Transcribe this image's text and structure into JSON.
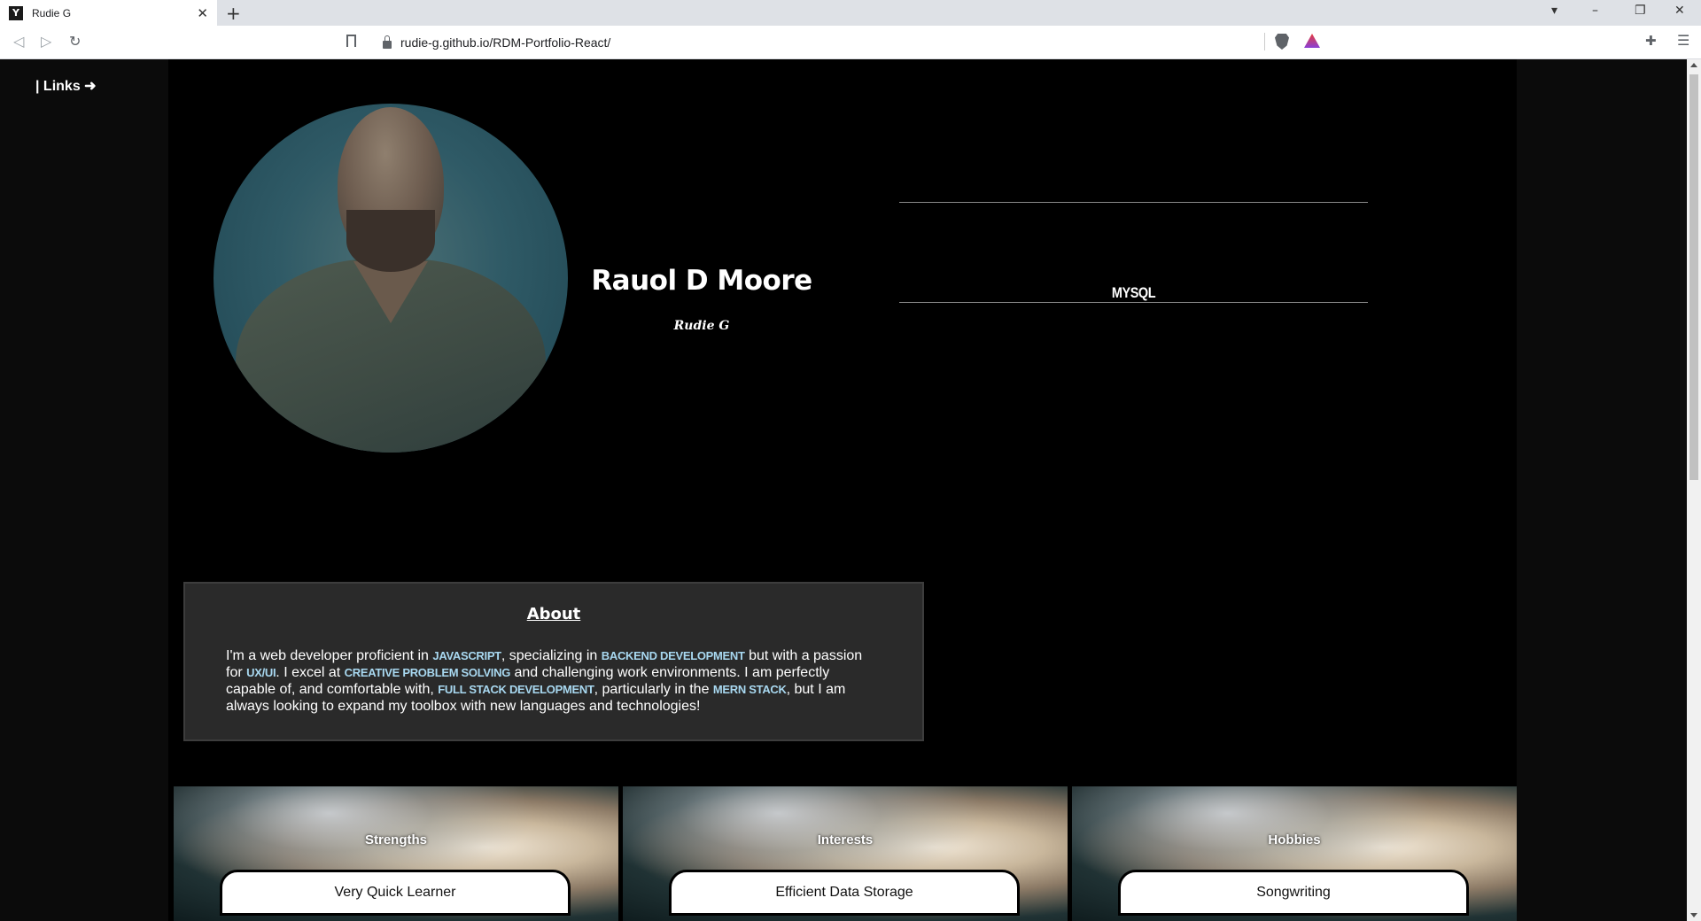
{
  "browser": {
    "tab_title": "Rudie G",
    "url": "rudie-g.github.io/RDM-Portfolio-React/"
  },
  "sidebar": {
    "links_label": "| Links ➜"
  },
  "profile": {
    "name": "Rauol D Moore",
    "nickname": "Rudie G",
    "current_skill": "MYSQL"
  },
  "about": {
    "title": "About",
    "p1": "I'm a web developer proficient in ",
    "h1": "JAVASCRIPT",
    "p2": ", specializing in ",
    "h2": "BACKEND DEVELOPMENT",
    "p3": " but with a passion for ",
    "h3": "UX/UI",
    "p4": ". I excel at ",
    "h4": "CREATIVE PROBLEM SOLVING",
    "p5": " and challenging work environments. I am perfectly capable of, and comfortable with, ",
    "h5": "FULL STACK DEVELOPMENT",
    "p6": ", particularly in the ",
    "h6": "MERN STACK",
    "p7": ", but I am always looking to expand my toolbox with new languages and technologies!"
  },
  "cards": [
    {
      "title": "Strengths",
      "value": "Very Quick Learner"
    },
    {
      "title": "Interests",
      "value": "Efficient Data Storage"
    },
    {
      "title": "Hobbies",
      "value": "Songwriting"
    }
  ],
  "colors": {
    "highlight": "#a8d8f0",
    "about_bg": "#2a2a2a"
  }
}
